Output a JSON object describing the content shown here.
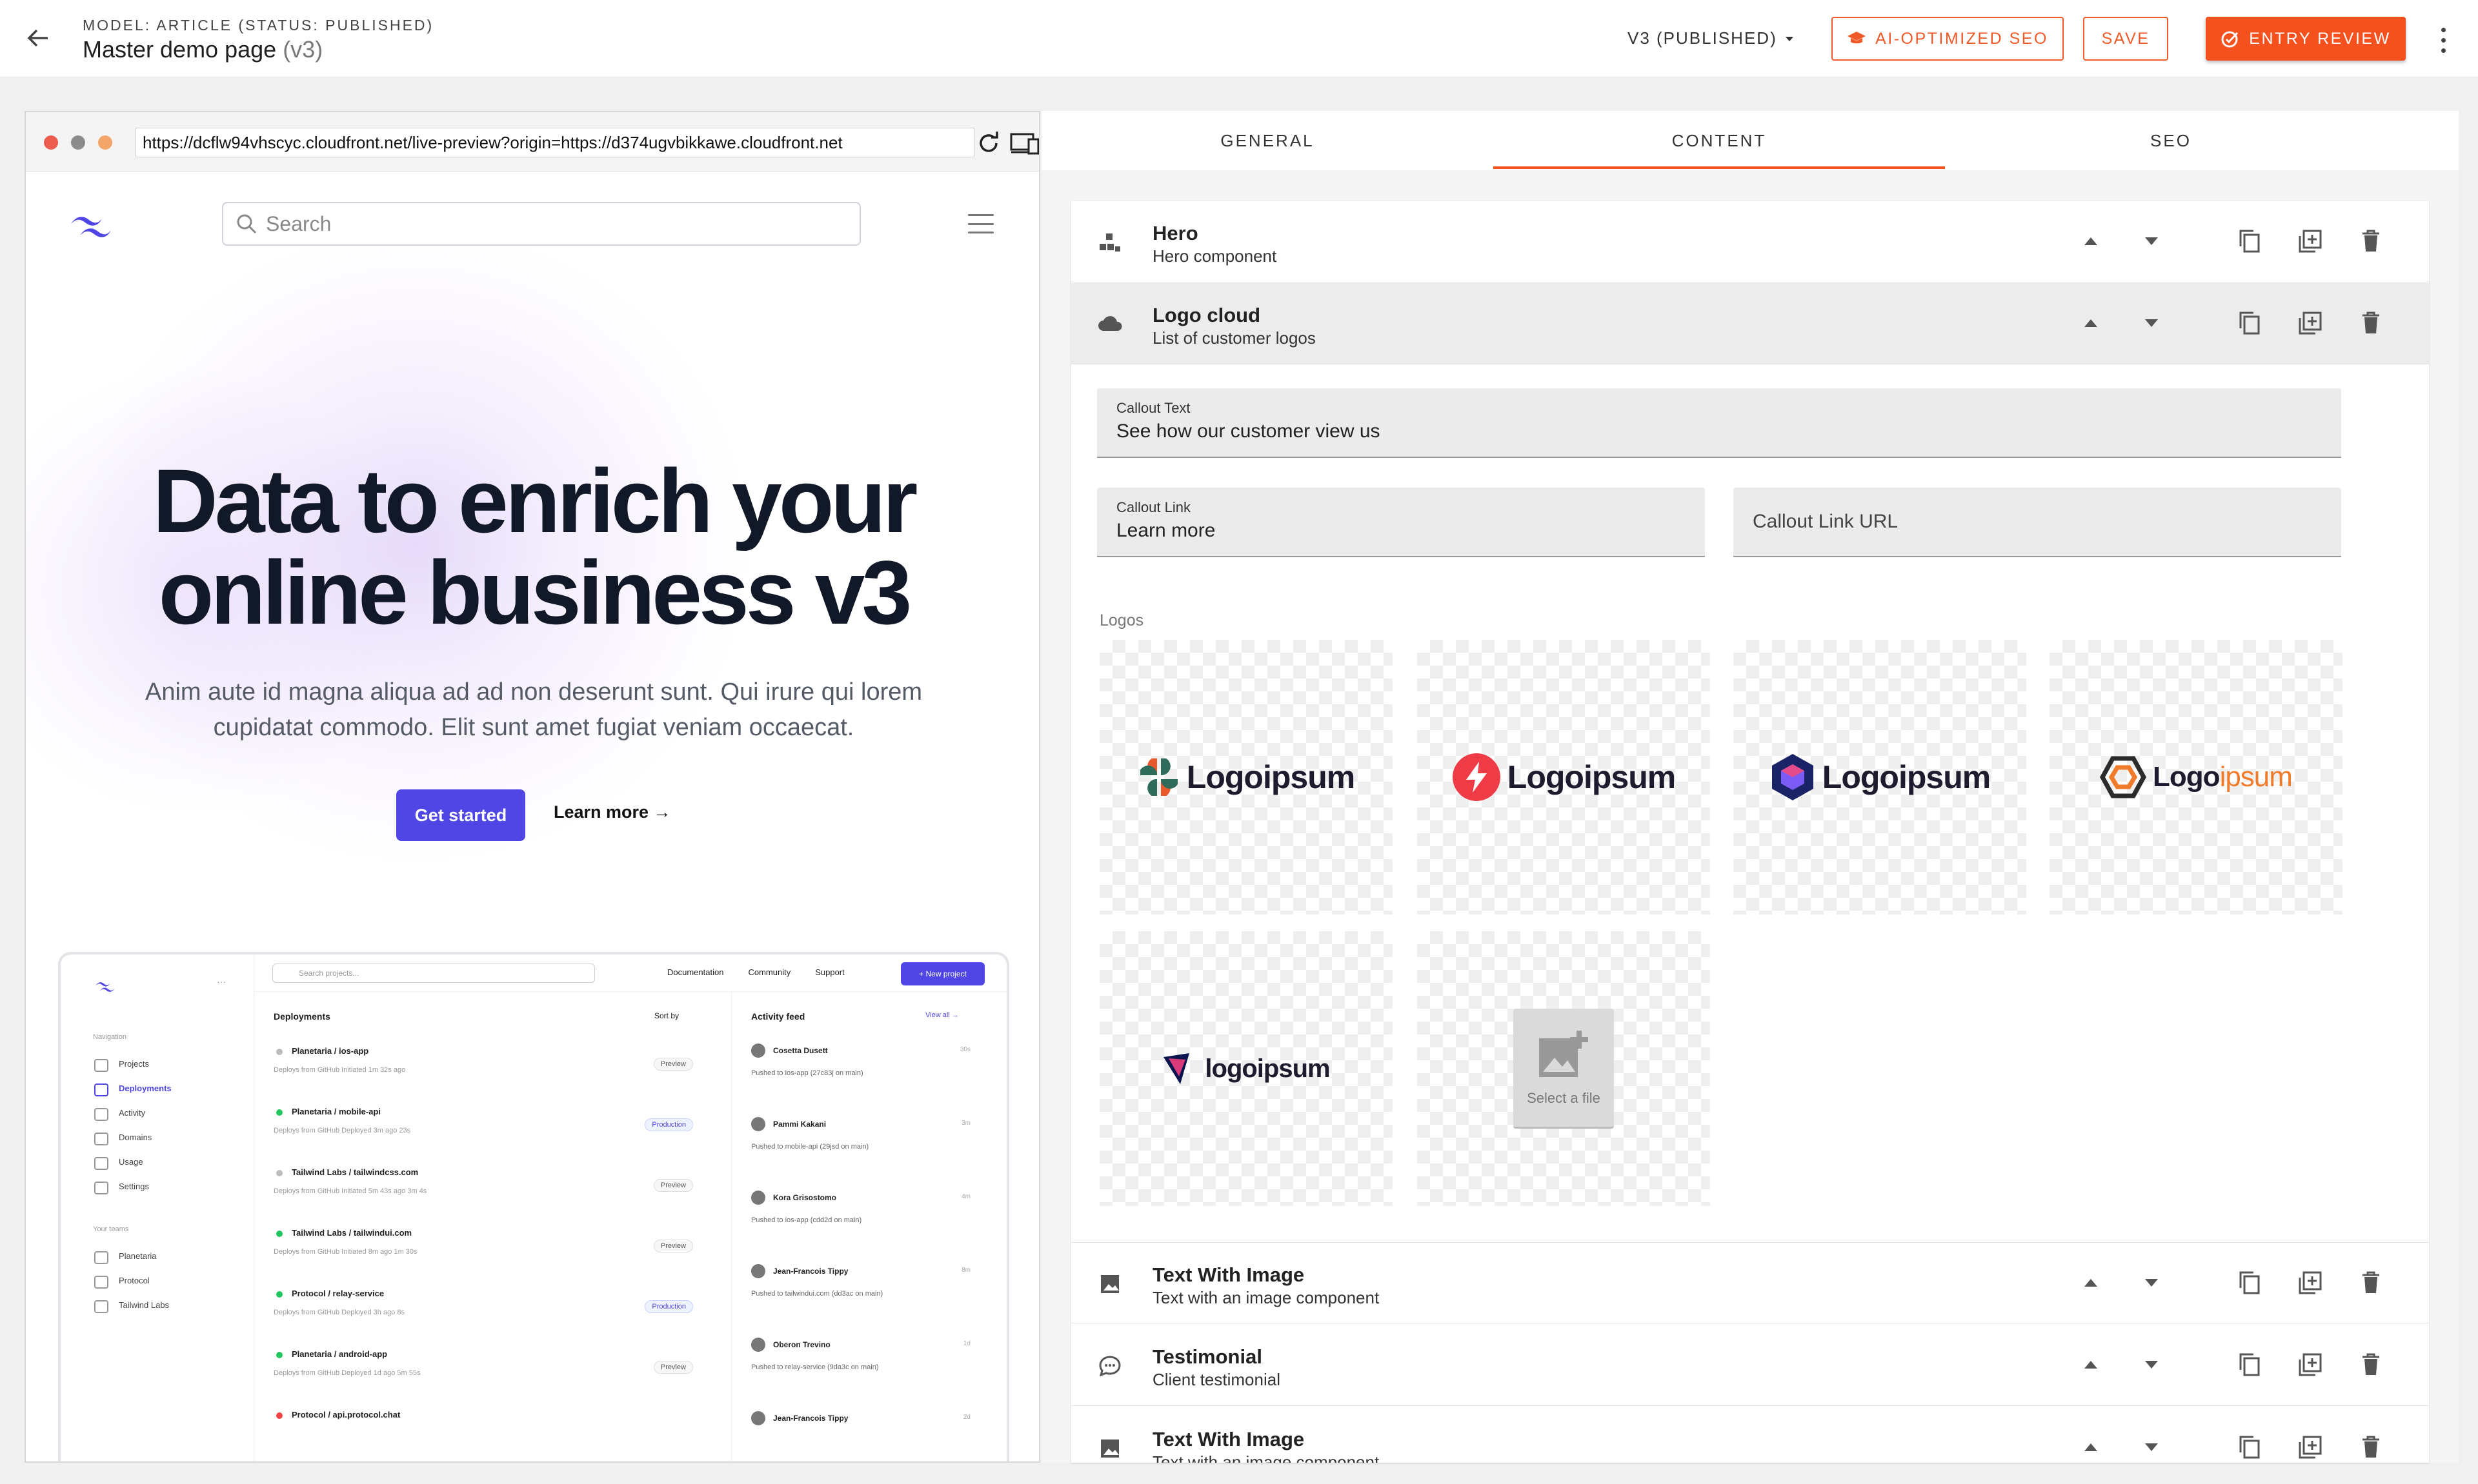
{
  "header": {
    "model_label": "MODEL: ARTICLE (STATUS: PUBLISHED)",
    "page_title": "Master demo page",
    "page_version": "(v3)",
    "version_select": "V3 (PUBLISHED)",
    "seo_button": "AI-OPTIMIZED SEO",
    "save_button": "SAVE",
    "review_button": "ENTRY REVIEW"
  },
  "preview": {
    "url": "https://dcflw94vhscyc.cloudfront.net/live-preview?origin=https://d374ugvbikkawe.cloudfront.net",
    "site": {
      "search_placeholder": "Search",
      "headline": "Data to enrich your online business v3",
      "paragraph": "Anim aute id magna aliqua ad ad non deserunt sunt. Qui irure qui lorem cupidatat commodo. Elit sunt amet fugiat veniam occaecat.",
      "cta_primary": "Get started",
      "cta_secondary": "Learn more →",
      "screenshot": {
        "search_placeholder": "Search projects...",
        "nav_links": [
          "Documentation",
          "Community",
          "Support"
        ],
        "new_project": "+ New project",
        "navigation_label": "Navigation",
        "sidebar": [
          "Projects",
          "Deployments",
          "Activity",
          "Domains",
          "Usage",
          "Settings"
        ],
        "teams_label": "Your teams",
        "teams": [
          "Planetaria",
          "Protocol",
          "Tailwind Labs"
        ],
        "deployments_title": "Deployments",
        "sort_by": "Sort by",
        "deployments": [
          {
            "title": "Planetaria  /  ios-app",
            "sub": "Deploys from GitHub    Initiated 1m 32s ago",
            "badge": "Preview",
            "status": "gray"
          },
          {
            "title": "Planetaria  /  mobile-api",
            "sub": "Deploys from GitHub    Deployed 3m ago    23s",
            "badge": "Production",
            "status": "green"
          },
          {
            "title": "Tailwind Labs  /  tailwindcss.com",
            "sub": "Deploys from GitHub    Initiated 5m 43s ago    3m 4s",
            "badge": "Preview",
            "status": "gray"
          },
          {
            "title": "Tailwind Labs  /  tailwindui.com",
            "sub": "Deploys from GitHub    Initiated 8m ago    1m 30s",
            "badge": "Preview",
            "status": "green"
          },
          {
            "title": "Protocol  /  relay-service",
            "sub": "Deploys from GitHub    Deployed 3h ago    8s",
            "badge": "Production",
            "status": "green"
          },
          {
            "title": "Planetaria  /  android-app",
            "sub": "Deploys from GitHub    Deployed 1d ago    5m 55s",
            "badge": "Preview",
            "status": "green"
          },
          {
            "title": "Protocol  /  api.protocol.chat",
            "sub": "",
            "badge": "",
            "status": "red"
          }
        ],
        "activity_title": "Activity feed",
        "view_all": "View all →",
        "activity": [
          {
            "name": "Cosetta Dusett",
            "time": "30s",
            "sub": "Pushed to ios-app (27c83j on main)"
          },
          {
            "name": "Pammi Kakani",
            "time": "3m",
            "sub": "Pushed to mobile-api (29jsd on main)"
          },
          {
            "name": "Kora Grisostomo",
            "time": "4m",
            "sub": "Pushed to ios-app (cdd2d on main)"
          },
          {
            "name": "Jean-Francois Tippy",
            "time": "8m",
            "sub": "Pushed to tailwindui.com (dd3ac on main)"
          },
          {
            "name": "Oberon Trevino",
            "time": "1d",
            "sub": "Pushed to relay-service (9da3c on main)"
          },
          {
            "name": "Jean-Francois Tippy",
            "time": "2d",
            "sub": ""
          }
        ]
      }
    }
  },
  "editor": {
    "tabs": [
      "GENERAL",
      "CONTENT",
      "SEO"
    ],
    "active_tab": "CONTENT",
    "blocks": [
      {
        "title": "Hero",
        "subtitle": "Hero component"
      },
      {
        "title": "Logo cloud",
        "subtitle": "List of customer logos"
      },
      {
        "title": "Text With Image",
        "subtitle": "Text with an image component"
      },
      {
        "title": "Testimonial",
        "subtitle": "Client testimonial"
      },
      {
        "title": "Text With Image",
        "subtitle": "Text with an image component"
      }
    ],
    "logo_cloud": {
      "callout_text_label": "Callout Text",
      "callout_text_value": "See how our customer view us",
      "callout_link_label": "Callout Link",
      "callout_link_value": "Learn more",
      "callout_link_url_placeholder": "Callout Link URL",
      "logos_label": "Logos",
      "logos": [
        "Logoipsum",
        "Logoipsum",
        "Logoipsum",
        "Logoipsum",
        "logoipsum"
      ],
      "logo4_parts": [
        "Logo",
        "ipsum"
      ],
      "select_file": "Select a file"
    }
  },
  "colors": {
    "accent": "#f4511e",
    "site_primary": "#4f46e5"
  }
}
